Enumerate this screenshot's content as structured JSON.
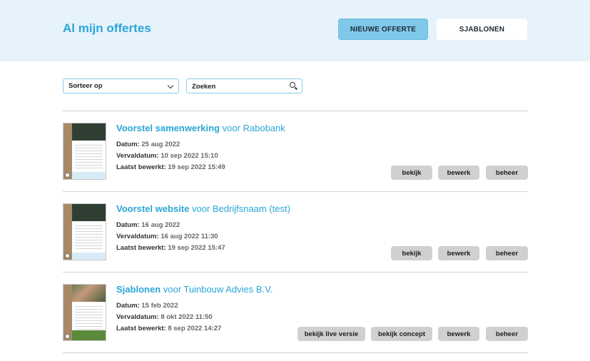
{
  "header": {
    "title": "Al mijn offertes",
    "new_button": "NIEUWE OFFERTE",
    "templates_button": "SJABLONEN"
  },
  "filters": {
    "sort_label": "Sorteer op",
    "search_placeholder": "Zoeken"
  },
  "labels": {
    "datum": "Datum:",
    "vervaldatum": "Vervaldatum:",
    "laatst_bewerkt": "Laatst bewerkt:"
  },
  "items": [
    {
      "title": "Voorstel samenwerking",
      "client": "voor Rabobank",
      "datum": "25 aug 2022",
      "vervaldatum": "10 sep 2022 15:10",
      "laatst_bewerkt": "19 sep 2022 15:49",
      "actions": [
        "bekijk",
        "bewerk",
        "beheer"
      ]
    },
    {
      "title": "Voorstel website",
      "client": "voor Bedrijfsnaam (test)",
      "datum": "16 aug 2022",
      "vervaldatum": "16 aug 2022 11:30",
      "laatst_bewerkt": "19 sep 2022 15:47",
      "actions": [
        "bekijk",
        "bewerk",
        "beheer"
      ]
    },
    {
      "title": "Sjablonen",
      "client": "voor Tuinbouw Advies B.V.",
      "datum": "15 feb 2022",
      "vervaldatum": "8 okt 2022 11:50",
      "laatst_bewerkt": "8 sep 2022 14:27",
      "actions": [
        "bekijk live versie",
        "bekijk concept",
        "bewerk",
        "beheer"
      ]
    }
  ],
  "colors": {
    "accent": "#2aa6d6",
    "header_bg": "#e6f3fb",
    "primary_button": "#7fc8ea",
    "action_button": "#d0d0d0"
  },
  "icons": {
    "sort": "chevron-down-icon",
    "search": "search-icon"
  }
}
